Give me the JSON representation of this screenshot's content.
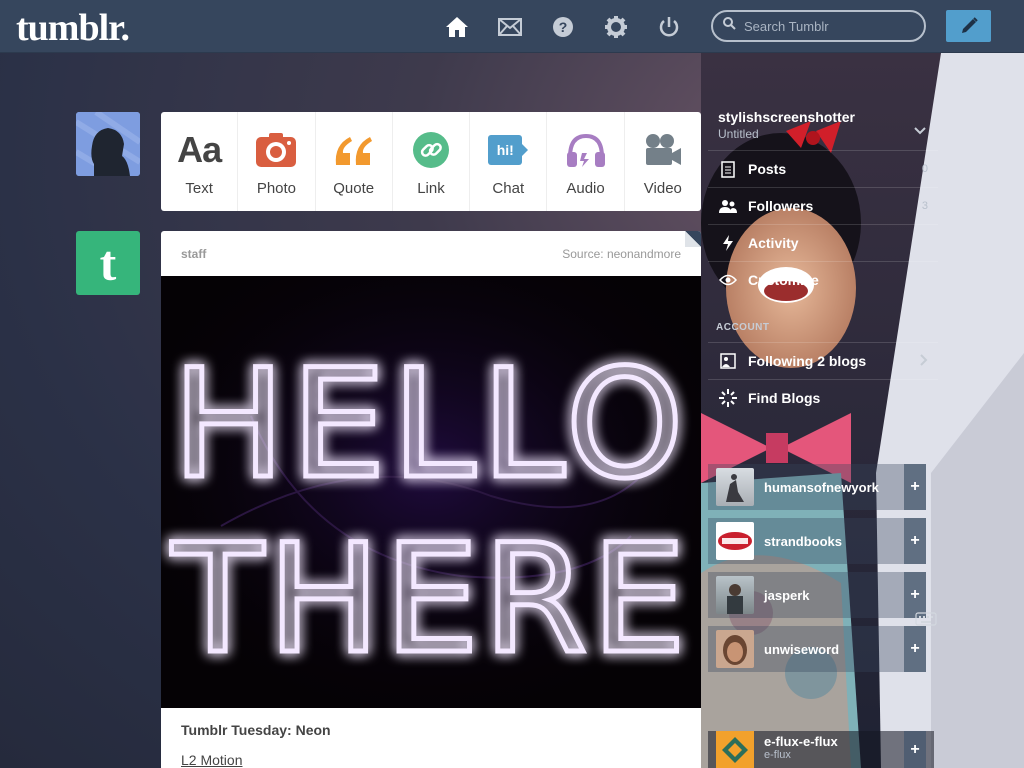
{
  "header": {
    "logo": "tumblr.",
    "search_placeholder": "Search Tumblr"
  },
  "post_types": [
    {
      "label": "Text",
      "glyph": "Aa",
      "color": "#444444"
    },
    {
      "label": "Photo",
      "color": "#d95e40"
    },
    {
      "label": "Quote",
      "glyph": "“",
      "color": "#f2992e"
    },
    {
      "label": "Link",
      "color": "#56bc8a"
    },
    {
      "label": "Chat",
      "glyph": "hi!",
      "color": "#529ecc"
    },
    {
      "label": "Audio",
      "color": "#a77dc2"
    },
    {
      "label": "Video",
      "color": "#748089"
    }
  ],
  "staff_avatar_letter": "t",
  "post": {
    "author": "staff",
    "source": "Source: neonandmore",
    "title": "Tumblr Tuesday: Neon",
    "link": "L2 Motion",
    "neon_line1": "HELLO",
    "neon_line2": "THERE"
  },
  "sidebar": {
    "blog_name": "stylishscreenshotter",
    "blog_subtitle": "Untitled",
    "items": [
      {
        "label": "Posts",
        "count": "0"
      },
      {
        "label": "Followers",
        "count": "3"
      },
      {
        "label": "Activity",
        "count": ""
      },
      {
        "label": "Customize",
        "count": ""
      }
    ],
    "account_label": "ACCOUNT",
    "account_items": [
      {
        "label": "Following 2 blogs"
      },
      {
        "label": "Find Blogs"
      }
    ]
  },
  "recommended": [
    {
      "name": "humansofnewyork"
    },
    {
      "name": "strandbooks"
    },
    {
      "name": "jasperk"
    },
    {
      "name": "unwiseword"
    }
  ],
  "last_recommended": {
    "name": "e-flux-e-flux",
    "sub": "e-flux"
  },
  "colors": {
    "header": "#36465d",
    "accent": "#529ecc",
    "staff_green": "#36b57b"
  }
}
